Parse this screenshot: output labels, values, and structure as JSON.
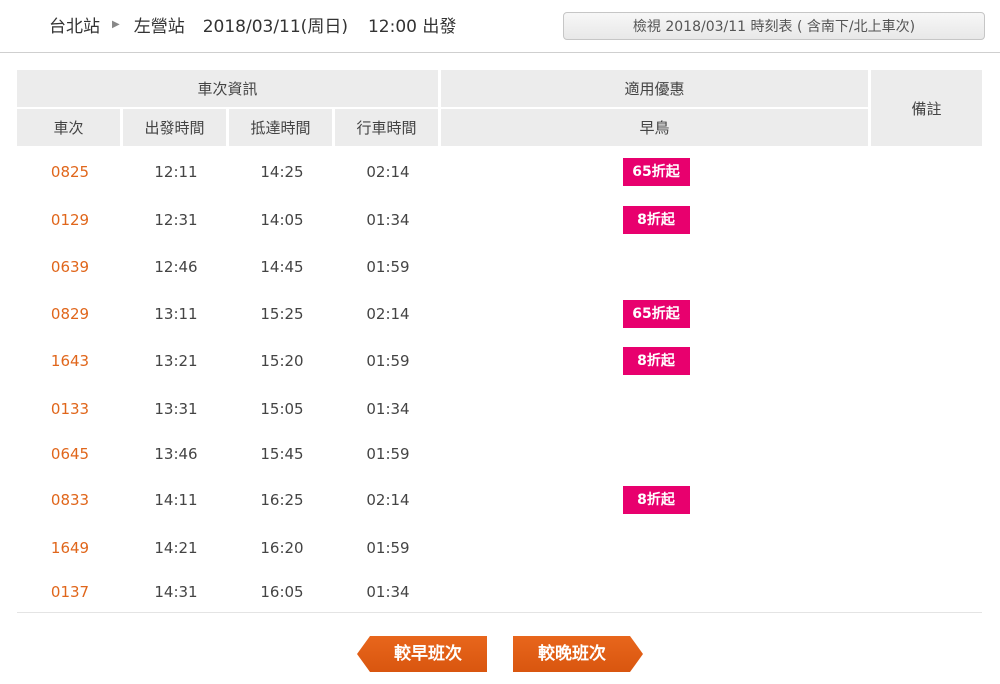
{
  "header": {
    "origin": "台北站",
    "destination": "左營站",
    "date": "2018/03/11(周日)",
    "departure": "12:00 出發",
    "view_button": "檢視 2018/03/11 時刻表 ( 含南下/北上車次)"
  },
  "table": {
    "group_train_info": "車次資訊",
    "group_discounts": "適用優惠",
    "notes_header": "備註",
    "col_train": "車次",
    "col_depart": "出發時間",
    "col_arrive": "抵達時間",
    "col_duration": "行車時間",
    "col_early_bird": "早鳥",
    "rows": [
      {
        "train": "0825",
        "depart": "12:11",
        "arrive": "14:25",
        "duration": "02:14",
        "discount": "65折起"
      },
      {
        "train": "0129",
        "depart": "12:31",
        "arrive": "14:05",
        "duration": "01:34",
        "discount": "8折起"
      },
      {
        "train": "0639",
        "depart": "12:46",
        "arrive": "14:45",
        "duration": "01:59",
        "discount": ""
      },
      {
        "train": "0829",
        "depart": "13:11",
        "arrive": "15:25",
        "duration": "02:14",
        "discount": "65折起"
      },
      {
        "train": "1643",
        "depart": "13:21",
        "arrive": "15:20",
        "duration": "01:59",
        "discount": "8折起"
      },
      {
        "train": "0133",
        "depart": "13:31",
        "arrive": "15:05",
        "duration": "01:34",
        "discount": ""
      },
      {
        "train": "0645",
        "depart": "13:46",
        "arrive": "15:45",
        "duration": "01:59",
        "discount": ""
      },
      {
        "train": "0833",
        "depart": "14:11",
        "arrive": "16:25",
        "duration": "02:14",
        "discount": "8折起"
      },
      {
        "train": "1649",
        "depart": "14:21",
        "arrive": "16:20",
        "duration": "01:59",
        "discount": ""
      },
      {
        "train": "0137",
        "depart": "14:31",
        "arrive": "16:05",
        "duration": "01:34",
        "discount": ""
      }
    ]
  },
  "pager": {
    "earlier": "較早班次",
    "later": "較晚班次"
  },
  "colors": {
    "train_number": "#e0661b",
    "discount_badge": "#e8006e",
    "pager_button": "#e8661c",
    "header_cell": "#ececec"
  }
}
